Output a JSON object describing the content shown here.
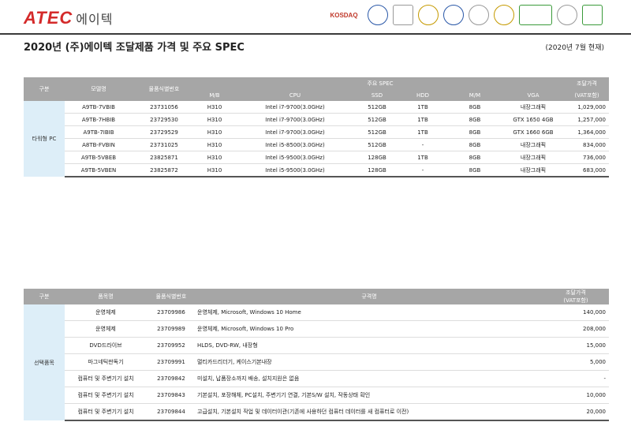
{
  "brand": {
    "logo_text": "ATEC",
    "logo_kr": "에이텍"
  },
  "badges": [
    {
      "icon": "kosdaq-badge",
      "text": "KOSDAQ"
    },
    {
      "icon": "seal-badge-1",
      "text": ""
    },
    {
      "icon": "seal-badge-2",
      "text": ""
    },
    {
      "icon": "seal-badge-3",
      "text": ""
    },
    {
      "icon": "seal-badge-4",
      "text": ""
    },
    {
      "icon": "seal-badge-5",
      "text": ""
    },
    {
      "icon": "seal-badge-6",
      "text": ""
    },
    {
      "icon": "eco-badge",
      "text": ""
    },
    {
      "icon": "taegeuk-badge",
      "text": ""
    },
    {
      "icon": "leaf-badge",
      "text": ""
    }
  ],
  "title": "2020년 (주)에이텍 조달제품 가격 및 주요 SPEC",
  "date": "(2020년 7월 현재)",
  "table1": {
    "headers": {
      "gubun": "구분",
      "model": "모델명",
      "prodno": "물품식별번호",
      "spec": "주요 SPEC",
      "price": "조달가격",
      "price_sub": "(VAT포함)",
      "mb": "M/B",
      "cpu": "CPU",
      "ssd": "SSD",
      "hdd": "HDD",
      "mm": "M/M",
      "vga": "VGA"
    },
    "group": "타워형 PC",
    "rows": [
      {
        "model": "A9TB-7VBIB",
        "no": "23731056",
        "mb": "H310",
        "cpu": "Intel i7-9700(3.0GHz)",
        "ssd": "512GB",
        "hdd": "1TB",
        "mm": "8GB",
        "vga": "내장그래픽",
        "price": "1,029,000"
      },
      {
        "model": "A9TB-7HBIB",
        "no": "23729530",
        "mb": "H310",
        "cpu": "Intel i7-9700(3.0GHz)",
        "ssd": "512GB",
        "hdd": "1TB",
        "mm": "8GB",
        "vga": "GTX 1650 4GB",
        "price": "1,257,000"
      },
      {
        "model": "A9TB-7IBIB",
        "no": "23729529",
        "mb": "H310",
        "cpu": "Intel i7-9700(3.0GHz)",
        "ssd": "512GB",
        "hdd": "1TB",
        "mm": "8GB",
        "vga": "GTX 1660 6GB",
        "price": "1,364,000"
      },
      {
        "model": "A8TB-FVBIN",
        "no": "23731025",
        "mb": "H310",
        "cpu": "Intel i5-8500(3.0GHz)",
        "ssd": "512GB",
        "hdd": "-",
        "mm": "8GB",
        "vga": "내장그래픽",
        "price": "834,000"
      },
      {
        "model": "A9TB-5VBEB",
        "no": "23825871",
        "mb": "H310",
        "cpu": "Intel i5-9500(3.0GHz)",
        "ssd": "128GB",
        "hdd": "1TB",
        "mm": "8GB",
        "vga": "내장그래픽",
        "price": "736,000"
      },
      {
        "model": "A9TB-5VBEN",
        "no": "23825872",
        "mb": "H310",
        "cpu": "Intel i5-9500(3.0GHz)",
        "ssd": "128GB",
        "hdd": "-",
        "mm": "8GB",
        "vga": "내장그래픽",
        "price": "683,000"
      }
    ]
  },
  "table2": {
    "headers": {
      "gubun": "구분",
      "name": "품목명",
      "prodno": "물품식별번호",
      "spec": "규격명",
      "price": "조달가격",
      "price_sub": "(VAT포함)"
    },
    "group": "선택품목",
    "rows": [
      {
        "name": "운영체제",
        "no": "23709986",
        "spec": "운영체제, Microsoft, Windows 10 Home",
        "price": "140,000"
      },
      {
        "name": "운영체제",
        "no": "23709989",
        "spec": "운영체제, Microsoft, Windows 10 Pro",
        "price": "208,000"
      },
      {
        "name": "DVD드라이브",
        "no": "23709952",
        "spec": "HLDS, DVD-RW, 내장형",
        "price": "15,000"
      },
      {
        "name": "마그네틱판독기",
        "no": "23709991",
        "spec": "멀티카드리더기, 케이스기본내장",
        "price": "5,000"
      },
      {
        "name": "컴퓨터 및 주변기기 설치",
        "no": "23709842",
        "spec": "미설치, 납품장소까지 배송, 설치지원은 없음",
        "price": "-"
      },
      {
        "name": "컴퓨터 및 주변기기 설치",
        "no": "23709843",
        "spec": "기본설치, 포장해체, PC설치, 주변기기 연결, 기본S/W 설치, 작동상태 확인",
        "price": "10,000"
      },
      {
        "name": "컴퓨터 및 주변기기 설치",
        "no": "23709844",
        "spec": "고급설치, 기본설치 작업 및 데이터이관(기존에 사용하던 컴퓨터 데이터를 새 컴퓨터로 이전)",
        "price": "20,000"
      }
    ]
  }
}
